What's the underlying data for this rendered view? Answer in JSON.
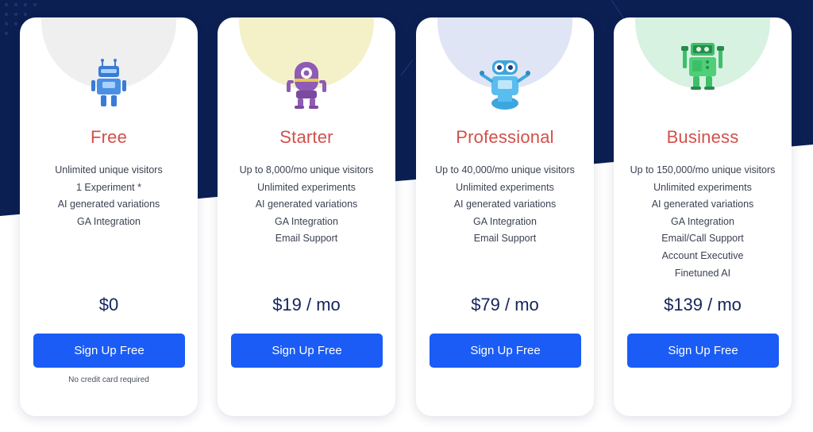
{
  "colors": {
    "navy_background": "#0c1f52",
    "button": "#1a5cf5",
    "plan_title": "#d2504b",
    "price": "#13245a"
  },
  "plans": [
    {
      "name": "Free",
      "robot_icon": "blue-robot-icon",
      "circle_color": "#efefef",
      "features": [
        "Unlimited unique visitors",
        "1 Experiment *",
        "AI generated variations",
        "GA Integration"
      ],
      "price": "$0",
      "button_label": "Sign Up Free",
      "note": "No credit card required"
    },
    {
      "name": "Starter",
      "robot_icon": "purple-robot-icon",
      "circle_color": "#f4f1c8",
      "features": [
        "Up to 8,000/mo unique visitors",
        "Unlimited experiments",
        "AI generated variations",
        "GA Integration",
        "Email Support"
      ],
      "price": "$19 / mo",
      "button_label": "Sign Up Free"
    },
    {
      "name": "Professional",
      "robot_icon": "cyan-robot-icon",
      "circle_color": "#dfe5f4",
      "features": [
        "Up to 40,000/mo unique visitors",
        "Unlimited experiments",
        "AI generated variations",
        "GA Integration",
        "Email Support"
      ],
      "price": "$79 / mo",
      "button_label": "Sign Up Free"
    },
    {
      "name": "Business",
      "robot_icon": "green-robot-icon",
      "circle_color": "#d7f2e0",
      "features": [
        "Up to 150,000/mo unique visitors",
        "Unlimited experiments",
        "AI generated variations",
        "GA Integration",
        "Email/Call Support",
        "Account Executive",
        "Finetuned AI"
      ],
      "price": "$139 / mo",
      "button_label": "Sign Up Free"
    }
  ]
}
